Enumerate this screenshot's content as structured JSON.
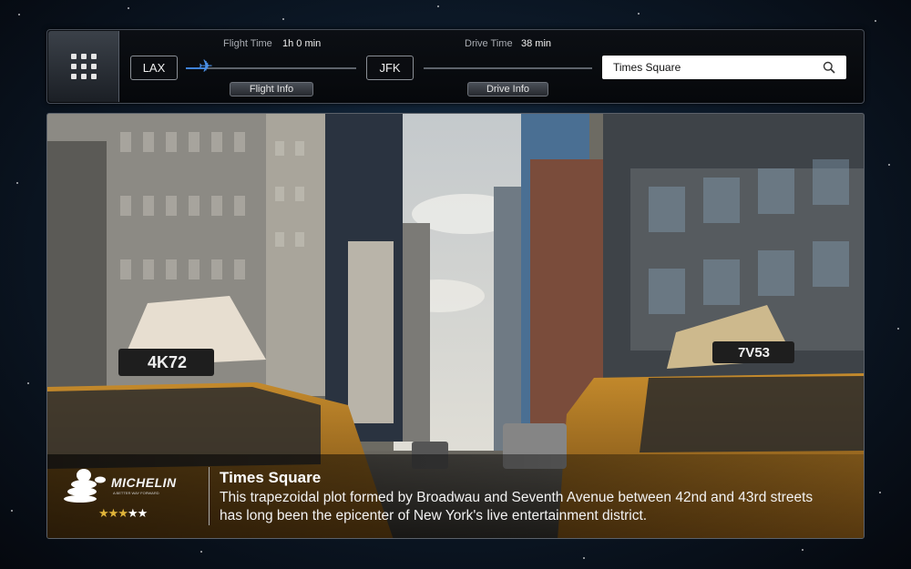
{
  "flight": {
    "origin": "LAX",
    "destination": "JFK",
    "time_label": "Flight Time",
    "time_value": "1h 0 min",
    "info_button": "Flight Info"
  },
  "drive": {
    "time_label": "Drive Time",
    "time_value": "38 min",
    "info_button": "Drive Info"
  },
  "search": {
    "value": "Times Square",
    "placeholder": ""
  },
  "place": {
    "title": "Times Square",
    "description": "This trapezoidal plot formed by Broadwau and Seventh Avenue between 42nd and 43rd streets has long been the epicenter of New York's live entertainment district.",
    "guide_logo": "MICHELIN",
    "guide_tagline": "A BETTER WAY FORWARD",
    "rating": 3,
    "rating_max": 5,
    "taxi_plate_left": "4K72",
    "taxi_plate_right": "7V53"
  },
  "colors": {
    "accent": "#3f82d8",
    "star_on": "#e0b43a"
  },
  "icons": {
    "menu": "grid-icon",
    "plane": "airplane-icon",
    "search": "search-icon"
  }
}
